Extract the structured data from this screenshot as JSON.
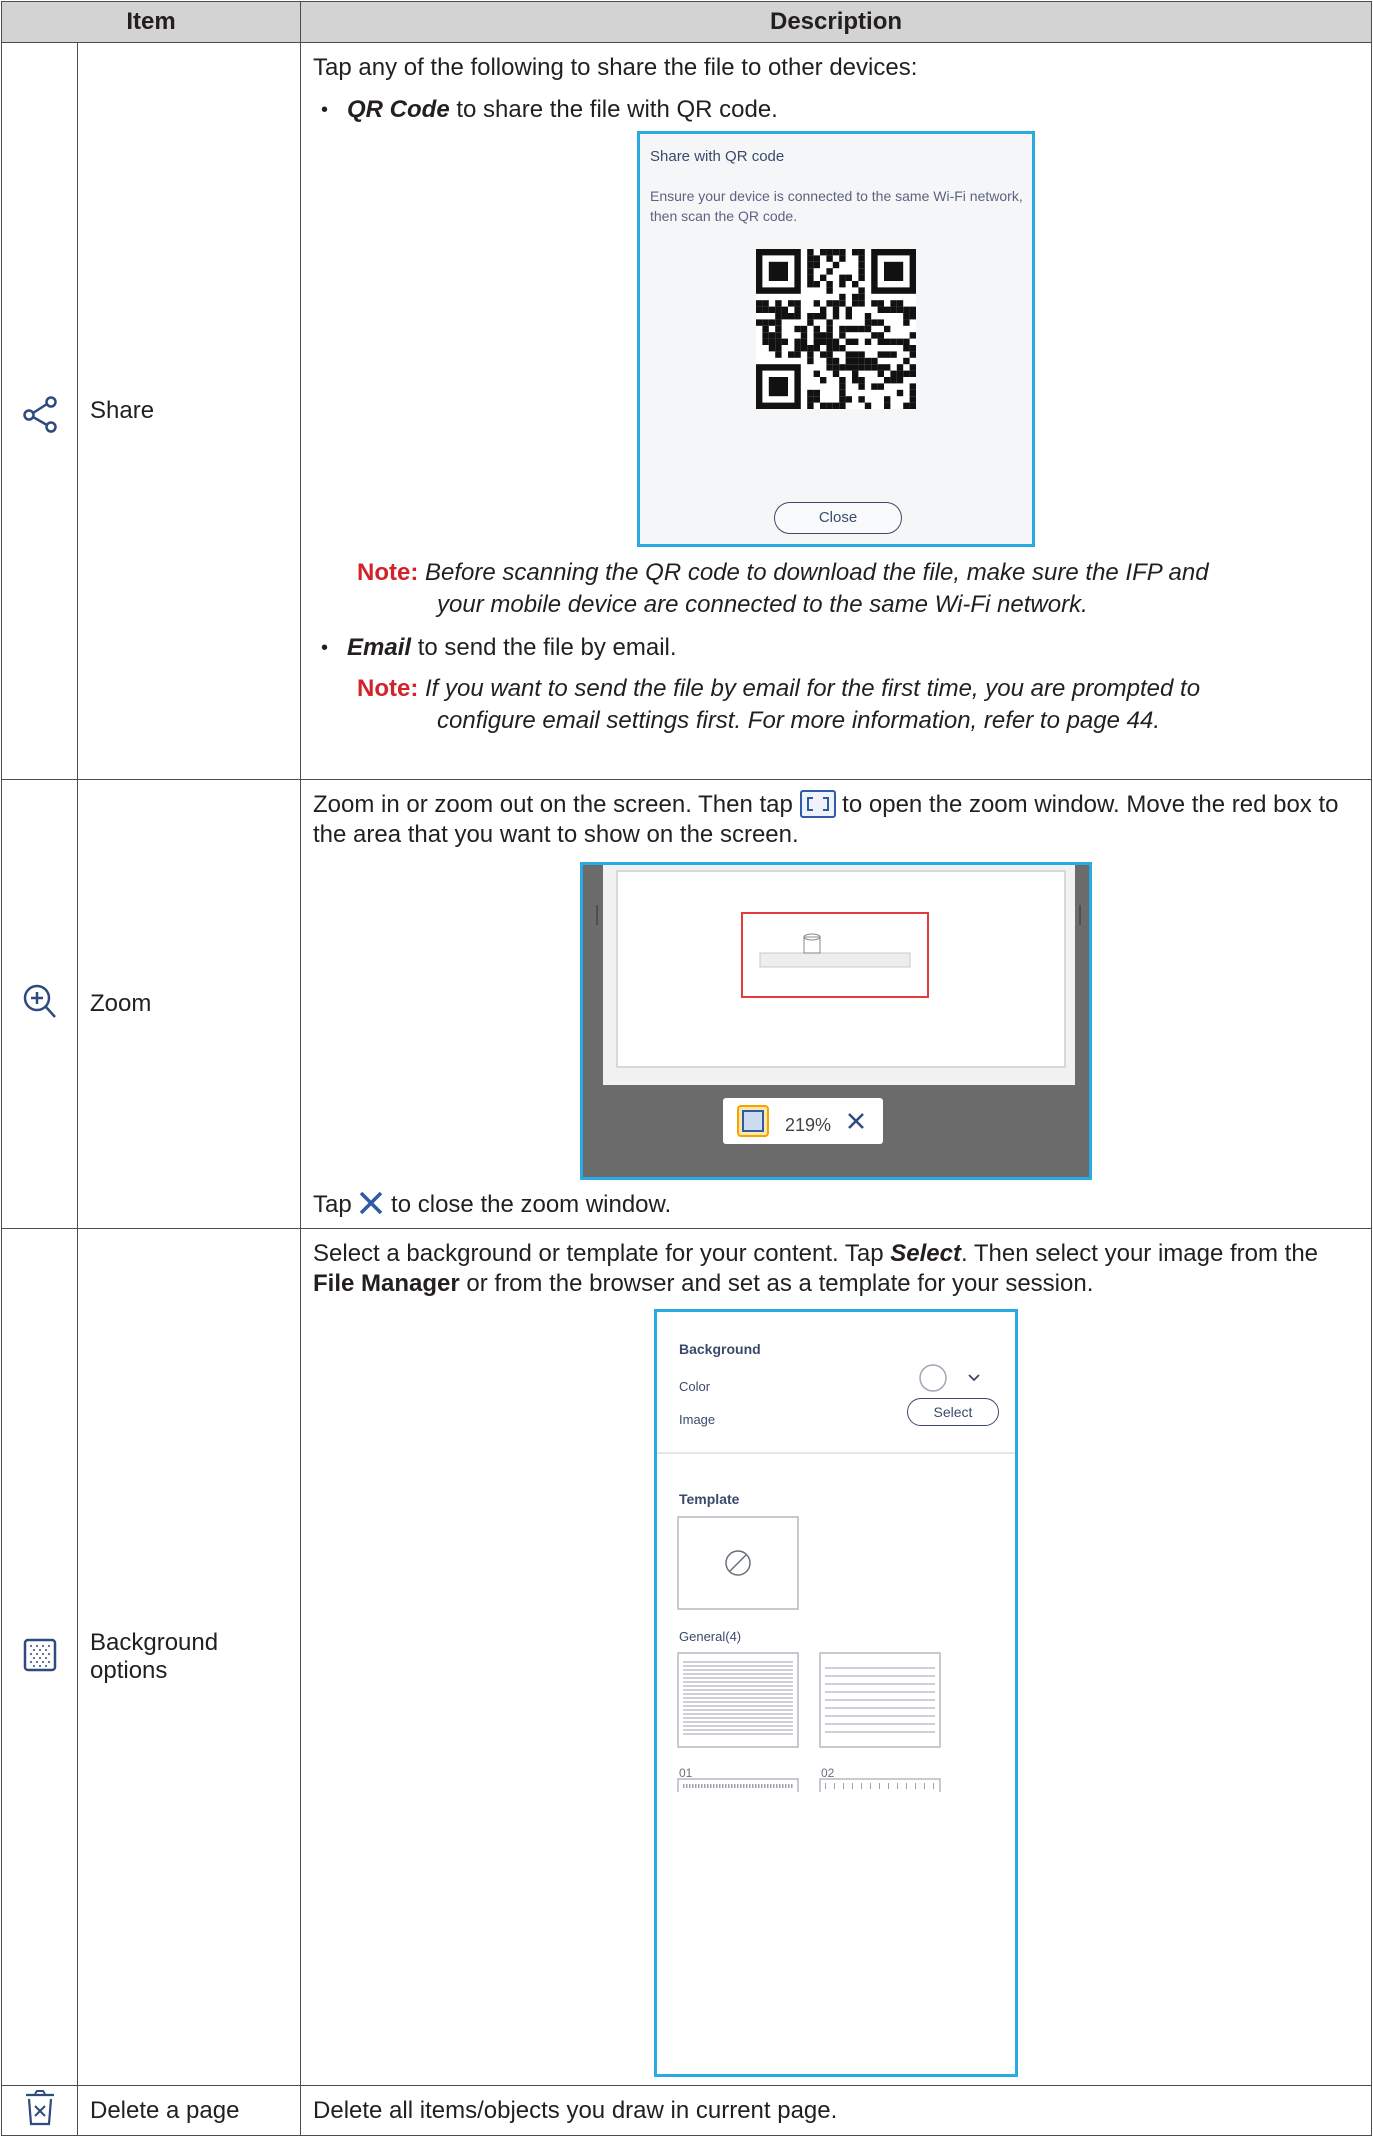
{
  "table": {
    "header_item": "Item",
    "header_description": "Description"
  },
  "rows": {
    "share": {
      "icon": "share-icon",
      "name": "Share",
      "intro": "Tap any of the following to share the file to other devices:",
      "qr_bold": "QR Code",
      "qr_text": " to share the file with QR code.",
      "qr_dialog": {
        "title": "Share with QR code",
        "message": "Ensure your device is connected to the same Wi-Fi network, then scan the QR code.",
        "close": "Close"
      },
      "note1_label": "Note:",
      "note1_line1": " Before scanning the QR code to download the file, make sure the IFP and",
      "note1_line2": "your mobile device are connected to the same Wi-Fi network.",
      "email_bold": "Email",
      "email_text": " to send the file by email.",
      "note2_label": "Note:",
      "note2_line1": " If you want to send the file by email for the first time, you are prompted to",
      "note2_line2": "configure email settings first. For more information, refer to page 44."
    },
    "zoom": {
      "icon": "zoom-in-icon",
      "name": "Zoom",
      "text_before": "Zoom in or zoom out on the screen. Then tap ",
      "text_after": " to open the zoom window. Move the red box to the area that you want to show on the screen.",
      "percent": "219%",
      "close_before": "Tap ",
      "close_after": " to close the zoom window."
    },
    "background": {
      "icon": "background-pattern-icon",
      "name": "Background options",
      "t1": "Select a background or template for your content. Tap ",
      "t1_bold": "Select",
      "t2": ". Then select your image from the ",
      "t2_bold": "File Manager",
      "t3": " or from the browser and set as a template for your session.",
      "panel": {
        "background_title": "Background",
        "color_label": "Color",
        "image_label": "Image",
        "select_button": "Select",
        "template_title": "Template",
        "general_label": "General(4)",
        "thumb1": "01",
        "thumb2": "02"
      }
    },
    "delete": {
      "icon": "delete-page-icon",
      "name": "Delete a page",
      "text": "Delete all items/objects you draw in current page."
    }
  }
}
